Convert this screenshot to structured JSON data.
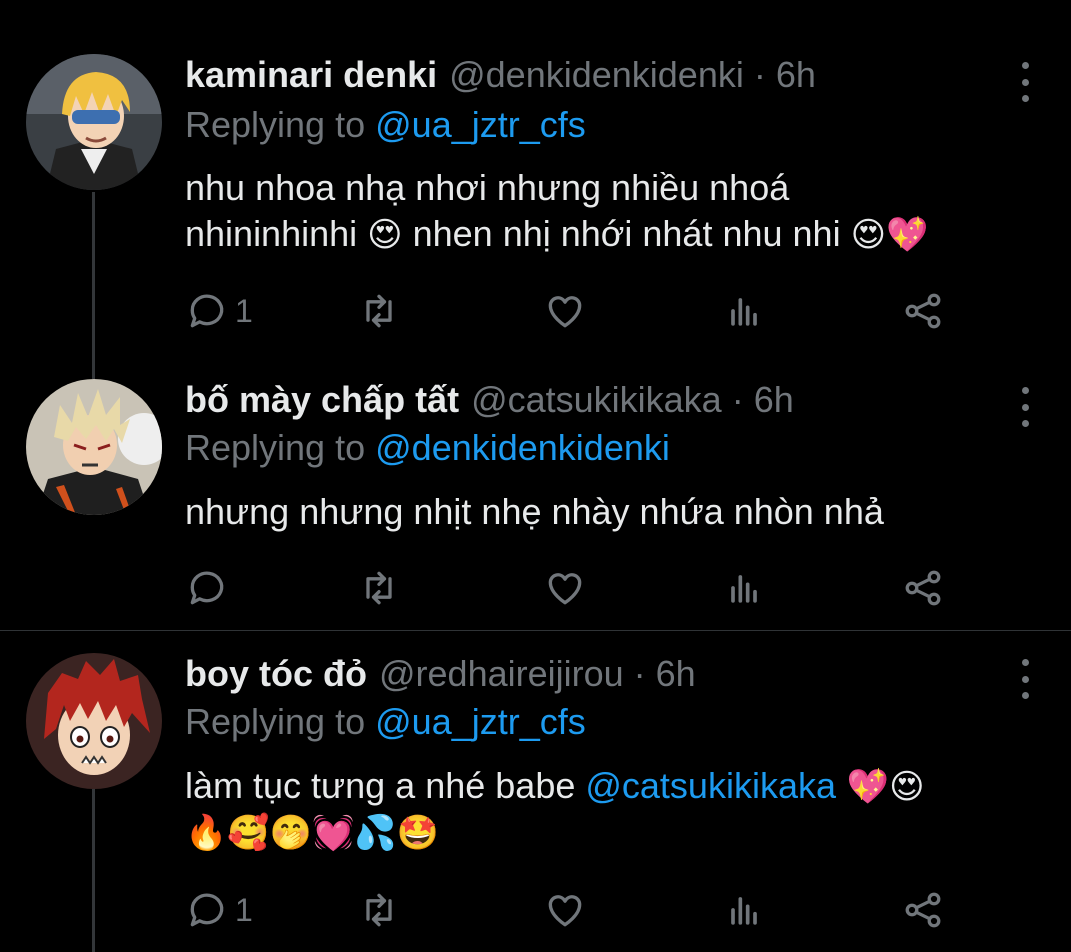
{
  "tweets": [
    {
      "display_name": "kaminari denki",
      "handle": "@denkidenkidenki",
      "separator": "·",
      "time": "6h",
      "replying_prefix": "Replying to",
      "replying_to": "@ua_jztr_cfs",
      "body_line1": "nhu nhoa nhạ nhơi nhưng nhiều nhoá",
      "body_line2_a": "nhininhinhi ",
      "body_line2_emoji1": "😍",
      "body_line2_b": " nhen nhị nhới nhát nhu nhi ",
      "body_line2_emoji2": "😍💖",
      "reply_count": "1",
      "avatar_hair": "#f0c040",
      "avatar_skin": "#f3d3b5"
    },
    {
      "display_name": "bố mày chấp tất",
      "handle": "@catsukikikaka",
      "separator": "·",
      "time": "6h",
      "replying_prefix": "Replying to",
      "replying_to": "@denkidenkidenki",
      "body_line1": "nhưng nhưng nhịt nhẹ nhày nhứa nhòn nhả",
      "reply_count": "",
      "avatar_hair": "#e8d9a8",
      "avatar_skin": "#f1cfb0"
    },
    {
      "display_name": "boy tóc đỏ",
      "handle": "@redhaireijirou",
      "separator": "·",
      "time": "6h",
      "replying_prefix": "Replying to",
      "replying_to": "@ua_jztr_cfs",
      "body_line1_a": "làm tục tưng a nhé babe ",
      "body_line1_mention": "@catsukikikaka",
      "body_line1_emoji": " 💖😍",
      "body_line2_emoji": "🔥🥰🤭💓💦🤩",
      "reply_count": "1",
      "avatar_hair": "#b3261e",
      "avatar_skin": "#f2d2b6"
    }
  ],
  "icons": {
    "reply": "reply-bubble-icon",
    "retweet": "retweet-icon",
    "like": "heart-icon",
    "views": "views-bar-icon",
    "share": "share-icon",
    "more": "more-vertical-icon"
  },
  "colors": {
    "background": "#000000",
    "text": "#e7e9ea",
    "secondary": "#71767b",
    "link": "#1d9bf0",
    "divider": "#2f3336"
  }
}
